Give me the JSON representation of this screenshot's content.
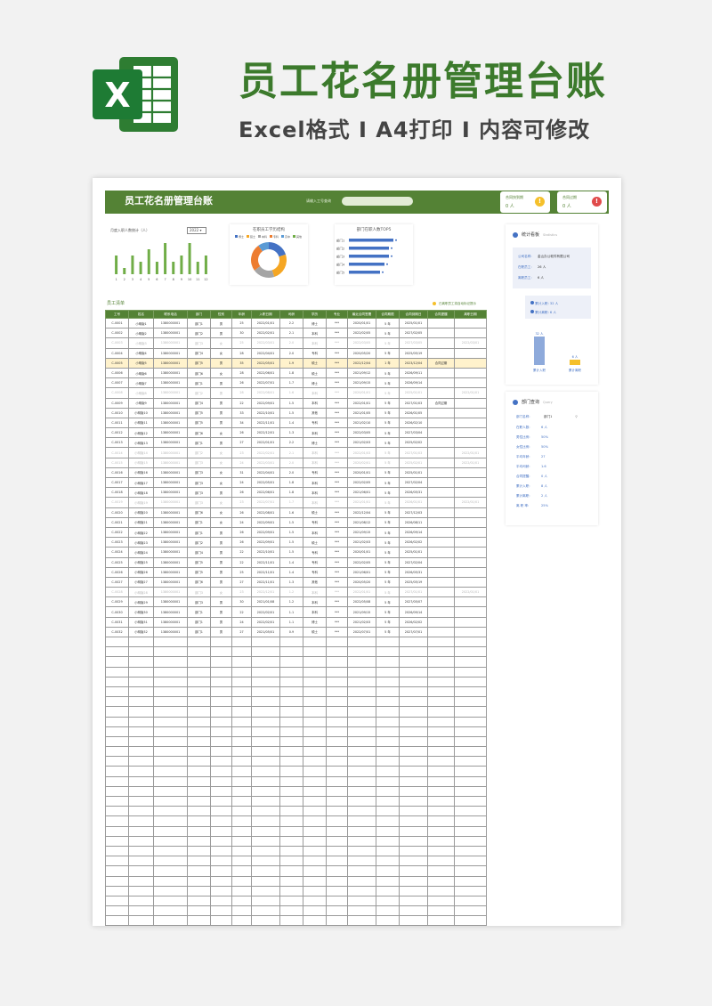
{
  "hero": {
    "title": "员工花名册管理台账",
    "subtitle": "Excel格式 I A4打印 I 内容可修改",
    "logo_letter": "X"
  },
  "topbar": {
    "title": "员工花名册管理台账",
    "search_label": "请输入工号查询",
    "search_value": ""
  },
  "cards": [
    {
      "label": "合同快到期",
      "value": "0 人"
    },
    {
      "label": "合同过期",
      "value": "0 人"
    }
  ],
  "chart_monthly": {
    "title": "月度入职人数统计（人）",
    "year": "2022",
    "chart_data": {
      "type": "bar",
      "categories": [
        "1",
        "2",
        "3",
        "4",
        "5",
        "6",
        "7",
        "8",
        "9",
        "10",
        "11",
        "12"
      ],
      "values": [
        3,
        1,
        3,
        2,
        4,
        2,
        5,
        2,
        3,
        5,
        2,
        3
      ],
      "color": "#70ad47"
    }
  },
  "chart_edu": {
    "title": "在职员工学历结构",
    "legend": [
      "博士",
      "硕士",
      "本科",
      "专科",
      "高中",
      "其他"
    ],
    "chart_data": {
      "type": "pie",
      "values": [
        20,
        25,
        20,
        25,
        10
      ],
      "colors": [
        "#4472c4",
        "#f5a623",
        "#a5a5a5",
        "#ed7d31",
        "#5b9bd5"
      ]
    }
  },
  "chart_top5": {
    "title": "部门在职人数TOP5",
    "chart_data": {
      "type": "bar",
      "orientation": "horizontal",
      "categories": [
        "部门1",
        "部门2",
        "部门3",
        "部门4",
        "部门5"
      ],
      "values": [
        10,
        9,
        9,
        8,
        7
      ],
      "color": "#4472c4"
    }
  },
  "list": {
    "section_label": "员工清单",
    "hint": "已离职员工将自动标记提示",
    "headers": [
      "工号",
      "姓名",
      "联系电话",
      "部门",
      "性别",
      "年龄",
      "入职日期",
      "司龄",
      "学历",
      "专业",
      "最近合同签署",
      "合同期限",
      "合同到期日",
      "合同提醒",
      "离职日期"
    ],
    "rows": [
      [
        "C-0001",
        "小明版1",
        "1380000001",
        "部门1",
        "男",
        "25",
        "2022/01/01",
        "2.2",
        "博士",
        "***",
        "2020/01/01",
        "5 年",
        "2025/01/01",
        "",
        ""
      ],
      [
        "C-0002",
        "小明版2",
        "1380000001",
        "部门2",
        "男",
        "30",
        "2022/02/01",
        "2.1",
        "本科",
        "***",
        "2022/02/05",
        "5 年",
        "2027/02/05",
        "",
        ""
      ],
      [
        "C-0003",
        "小明版3",
        "1380000001",
        "部门3",
        "女",
        "25",
        "2022/03/01",
        "2.0",
        "本科",
        "***",
        "2022/03/05",
        "5 年",
        "2027/03/05",
        "",
        "2022/03/01"
      ],
      [
        "C-0004",
        "小明版4",
        "1380000001",
        "部门4",
        "女",
        "28",
        "2022/04/01",
        "2.0",
        "专科",
        "***",
        "2020/05/20",
        "5 年",
        "2025/05/19",
        "",
        ""
      ],
      [
        "C-0005",
        "小明版5",
        "1380000001",
        "部门5",
        "男",
        "35",
        "2022/05/01",
        "1.9",
        "硕士",
        "***",
        "2022/12/04",
        "1 年",
        "2023/12/04",
        "合同过期",
        ""
      ],
      [
        "C-0006",
        "小明版6",
        "1380000001",
        "部门6",
        "女",
        "28",
        "2022/06/01",
        "1.8",
        "硕士",
        "***",
        "2021/09/12",
        "5 年",
        "2026/09/11",
        "",
        ""
      ],
      [
        "C-0007",
        "小明版7",
        "1380000001",
        "部门1",
        "男",
        "26",
        "2022/07/01",
        "1.7",
        "博士",
        "***",
        "2021/09/15",
        "5 年",
        "2026/09/14",
        "",
        ""
      ],
      [
        "C-0008",
        "小明版8",
        "1380000001",
        "部门2",
        "男",
        "28",
        "2022/08/01",
        "1.6",
        "本科",
        "***",
        "2020/01/01",
        "5 年",
        "2025/01/01",
        "",
        "2022/01/01"
      ],
      [
        "C-0009",
        "小明版9",
        "1380000001",
        "部门4",
        "男",
        "22",
        "2022/09/01",
        "1.5",
        "本科",
        "***",
        "2022/01/01",
        "5 年",
        "2027/01/03",
        "合同过期",
        ""
      ],
      [
        "C-0010",
        "小明版10",
        "1380000001",
        "部门5",
        "男",
        "33",
        "2022/10/01",
        "1.5",
        "其他",
        "***",
        "2021/01/05",
        "5 年",
        "2026/01/05",
        "",
        ""
      ],
      [
        "C-0011",
        "小明版11",
        "1380000001",
        "部门5",
        "男",
        "34",
        "2022/11/01",
        "1.4",
        "专科",
        "***",
        "2021/02/10",
        "5 年",
        "2026/02/10",
        "",
        ""
      ],
      [
        "C-0012",
        "小明版12",
        "1380000001",
        "部门6",
        "女",
        "26",
        "2022/12/01",
        "1.3",
        "本科",
        "***",
        "2022/03/05",
        "5 年",
        "2027/03/04",
        "",
        ""
      ],
      [
        "C-0013",
        "小明版13",
        "1380000001",
        "部门1",
        "男",
        "27",
        "2022/01/01",
        "2.2",
        "博士",
        "***",
        "2021/02/03",
        "5 年",
        "2025/02/02",
        "",
        ""
      ],
      [
        "C-0014",
        "小明版14",
        "1380000001",
        "部门2",
        "女",
        "23",
        "2022/02/01",
        "2.1",
        "本科",
        "***",
        "2022/01/03",
        "5 年",
        "2027/01/03",
        "",
        "2022/01/01"
      ],
      [
        "C-0015",
        "小明版15",
        "1380000001",
        "部门3",
        "女",
        "24",
        "2022/03/01",
        "2.0",
        "本科",
        "***",
        "2020/02/01",
        "5 年",
        "2025/02/01",
        "",
        "2022/01/01"
      ],
      [
        "C-0016",
        "小明版16",
        "1380000001",
        "部门3",
        "女",
        "31",
        "2022/04/01",
        "2.0",
        "专科",
        "***",
        "2020/01/01",
        "5 年",
        "2025/01/01",
        "",
        ""
      ],
      [
        "C-0017",
        "小明版17",
        "1380000001",
        "部门3",
        "女",
        "24",
        "2022/05/01",
        "1.8",
        "本科",
        "***",
        "2022/02/05",
        "5 年",
        "2027/02/04",
        "",
        ""
      ],
      [
        "C-0018",
        "小明版18",
        "1380000001",
        "部门3",
        "男",
        "26",
        "2022/06/01",
        "1.8",
        "本科",
        "***",
        "2021/06/01",
        "5 年",
        "2026/05/31",
        "",
        ""
      ],
      [
        "C-0019",
        "小明版19",
        "1380000001",
        "部门3",
        "女",
        "23",
        "2022/07/01",
        "1.7",
        "本科",
        "***",
        "2021/01/01",
        "5 年",
        "2026/01/01",
        "",
        "2022/01/01"
      ],
      [
        "C-0020",
        "小明版20",
        "1380000001",
        "部门6",
        "女",
        "26",
        "2022/08/01",
        "1.6",
        "硕士",
        "***",
        "2022/12/04",
        "5 年",
        "2027/12/03",
        "",
        ""
      ],
      [
        "C-0021",
        "小明版21",
        "1380000001",
        "部门1",
        "女",
        "24",
        "2022/09/01",
        "1.5",
        "专科",
        "***",
        "2021/08/12",
        "5 年",
        "2026/08/11",
        "",
        ""
      ],
      [
        "C-0022",
        "小明版22",
        "1380000001",
        "部门1",
        "男",
        "26",
        "2022/09/01",
        "1.5",
        "本科",
        "***",
        "2021/09/15",
        "5 年",
        "2026/09/14",
        "",
        ""
      ],
      [
        "C-0023",
        "小明版23",
        "1380000001",
        "部门2",
        "男",
        "26",
        "2022/09/01",
        "1.5",
        "硕士",
        "***",
        "2021/02/03",
        "5 年",
        "2026/02/02",
        "",
        ""
      ],
      [
        "C-0024",
        "小明版24",
        "1380000001",
        "部门4",
        "男",
        "22",
        "2022/10/01",
        "1.5",
        "专科",
        "***",
        "2020/01/01",
        "5 年",
        "2025/01/01",
        "",
        ""
      ],
      [
        "C-0025",
        "小明版25",
        "1380000001",
        "部门5",
        "男",
        "22",
        "2022/11/01",
        "1.4",
        "专科",
        "***",
        "2022/02/05",
        "5 年",
        "2027/02/04",
        "",
        ""
      ],
      [
        "C-0026",
        "小明版26",
        "1380000001",
        "部门5",
        "男",
        "25",
        "2022/11/01",
        "1.4",
        "专科",
        "***",
        "2021/06/01",
        "5 年",
        "2026/05/31",
        "",
        ""
      ],
      [
        "C-0027",
        "小明版27",
        "1380000001",
        "部门6",
        "男",
        "27",
        "2022/11/01",
        "1.3",
        "其他",
        "***",
        "2020/05/20",
        "5 年",
        "2025/05/19",
        "",
        ""
      ],
      [
        "C-0028",
        "小明版28",
        "1380000001",
        "部门3",
        "女",
        "23",
        "2022/12/01",
        "1.2",
        "本科",
        "***",
        "2022/01/01",
        "5 年",
        "2027/01/01",
        "",
        "2022/01/01"
      ],
      [
        "C-0029",
        "小明版29",
        "1380000001",
        "部门3",
        "男",
        "30",
        "2021/01/08",
        "1.2",
        "本科",
        "***",
        "2022/05/08",
        "5 年",
        "2027/05/07",
        "",
        ""
      ],
      [
        "C-0030",
        "小明版30",
        "1380000001",
        "部门1",
        "男",
        "22",
        "2022/02/01",
        "1.1",
        "本科",
        "***",
        "2021/09/15",
        "5 年",
        "2026/09/14",
        "",
        ""
      ],
      [
        "C-0031",
        "小明版31",
        "1380000001",
        "部门1",
        "男",
        "24",
        "2022/02/01",
        "1.1",
        "博士",
        "***",
        "2021/02/03",
        "5 年",
        "2026/02/02",
        "",
        ""
      ],
      [
        "C-0032",
        "小明版32",
        "1380000001",
        "部门1",
        "男",
        "27",
        "2021/05/01",
        "0.9",
        "硕士",
        "***",
        "2022/07/01",
        "5 年",
        "2027/07/01",
        "",
        ""
      ]
    ],
    "highlight_row": 4,
    "dim_rows": [
      2,
      7,
      13,
      14,
      18,
      27
    ]
  },
  "stats": {
    "title": "统计看板",
    "title_en": "Statistics",
    "company_label": "公司名称:",
    "company": "金山办公软件有限公司",
    "current_label": "在职员工:",
    "current": "26 人",
    "left_label": "离职员工:",
    "left": "6 人",
    "total_in_label": "累计入职:",
    "total_in": "32 人",
    "total_out_label": "累计离职:",
    "total_out": "6 人",
    "bar_in_label": "32 人",
    "bar_out_label": "6 人",
    "bar_in_caption": "累计入职",
    "bar_out_caption": "累计离职",
    "bars": [
      32,
      6
    ]
  },
  "query": {
    "title": "部门查询",
    "title_en": "Query",
    "dept_label": "部门名称:",
    "dept_value": "部门1",
    "fields": [
      {
        "label": "在职人数:",
        "value": "6 人"
      },
      {
        "label": "男性比例:",
        "value": "50%"
      },
      {
        "label": "女性比例:",
        "value": "50%"
      },
      {
        "label": "平均年龄:",
        "value": "27"
      },
      {
        "label": "平均司龄:",
        "value": "1.6"
      },
      {
        "label": "合同提醒:",
        "value": "0 人"
      },
      {
        "label": "累计入职:",
        "value": "8 人"
      },
      {
        "label": "累计离职:",
        "value": "2 人"
      },
      {
        "label": "离 职 率:",
        "value": "25%"
      }
    ]
  }
}
